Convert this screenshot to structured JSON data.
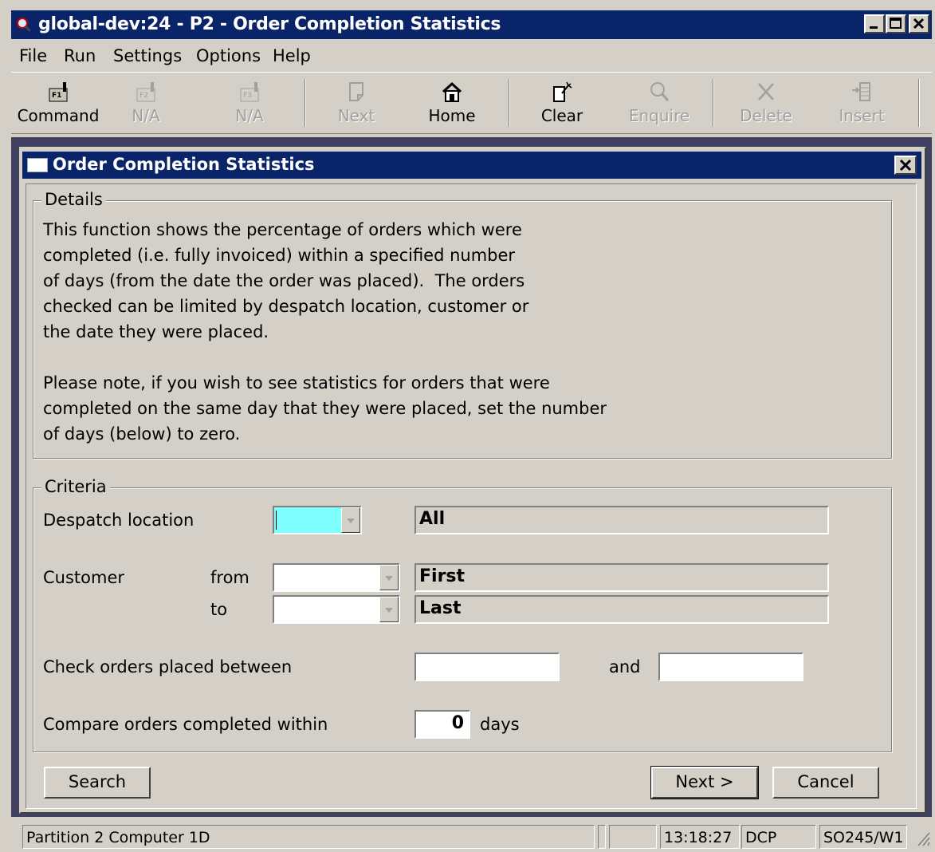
{
  "window": {
    "title": "global-dev:24 - P2 - Order Completion Statistics"
  },
  "menu": [
    "File",
    "Run",
    "Settings",
    "Options",
    "Help"
  ],
  "toolbar": [
    {
      "label": "Command",
      "icon": "f1-key-icon",
      "enabled": true
    },
    {
      "label": "N/A",
      "icon": "f2-key-icon",
      "enabled": false
    },
    {
      "label": "N/A",
      "icon": "f3-key-icon",
      "enabled": false
    },
    {
      "label": "Next",
      "icon": "next-page-icon",
      "enabled": false
    },
    {
      "label": "Home",
      "icon": "home-icon",
      "enabled": true
    },
    {
      "label": "Clear",
      "icon": "clear-icon",
      "enabled": true
    },
    {
      "label": "Enquire",
      "icon": "magnifier-icon",
      "enabled": false
    },
    {
      "label": "Delete",
      "icon": "delete-x-icon",
      "enabled": false
    },
    {
      "label": "Insert",
      "icon": "insert-icon",
      "enabled": false
    }
  ],
  "dialog": {
    "title": "Order Completion Statistics",
    "details": {
      "label": "Details",
      "paragraph1": "This function shows the percentage of orders which were\ncompleted (i.e. fully invoiced) within a specified number\nof days (from the date the order was placed).  The orders\nchecked can be limited by despatch location, customer or\nthe date they were placed.",
      "paragraph2": "Please note, if you wish to see statistics for orders that were\ncompleted on the same day that they were placed, set the number\nof days (below) to zero."
    },
    "criteria": {
      "label": "Criteria",
      "despatch_location": {
        "label": "Despatch location",
        "value": "",
        "description": "All"
      },
      "customer": {
        "label": "Customer",
        "from_label": "from",
        "to_label": "to",
        "from_value": "",
        "to_value": "",
        "from_description": "First",
        "to_description": "Last"
      },
      "date_range": {
        "label": "Check orders placed between",
        "and_label": "and",
        "start": "",
        "end": ""
      },
      "days": {
        "label": "Compare orders completed within",
        "value": "0",
        "unit": "days"
      }
    },
    "buttons": {
      "search": "Search",
      "next": "Next >",
      "cancel": "Cancel"
    }
  },
  "status": {
    "partition": "Partition 2 Computer 1D",
    "time": "13:18:27",
    "user": "DCP",
    "program": "SO245/W1"
  }
}
